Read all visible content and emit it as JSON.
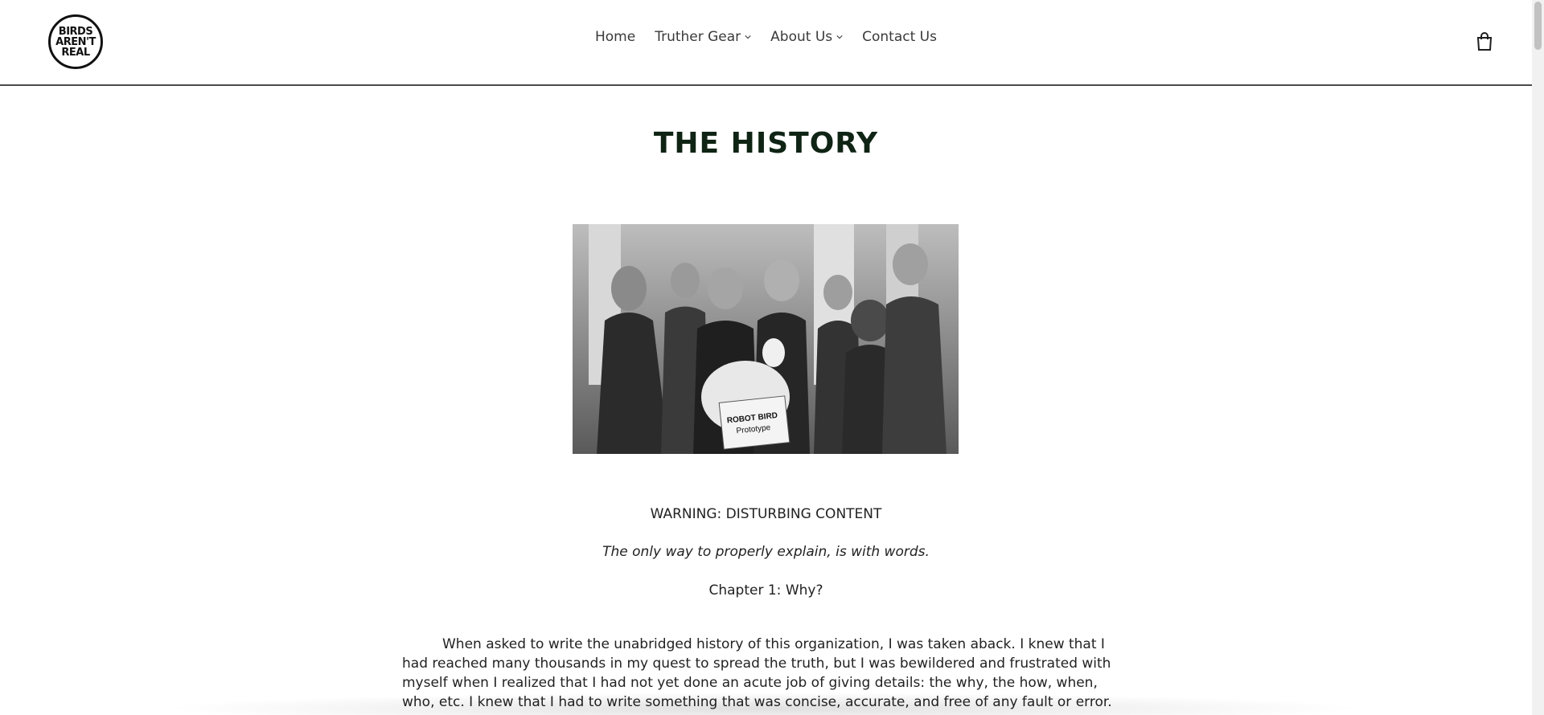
{
  "header": {
    "logo_lines": [
      "BIRDS",
      "AREN'T",
      "REAL"
    ],
    "nav": [
      {
        "label": "Home",
        "dropdown": false
      },
      {
        "label": "Truther Gear",
        "dropdown": true
      },
      {
        "label": "About Us",
        "dropdown": true
      },
      {
        "label": "Contact Us",
        "dropdown": false
      }
    ],
    "cart_icon": "shopping-bag-icon"
  },
  "main": {
    "title": "THE HISTORY",
    "hero_image": {
      "description_sign": "ROBOT BIRD\nPrototype",
      "sign_line1": "ROBOT BIRD",
      "sign_line2": "Prototype"
    },
    "warning": "WARNING: DISTURBING CONTENT",
    "lead": "The only way to properly explain, is with words.",
    "chapter": "Chapter 1: Why?",
    "paragraph": "When asked to write the unabridged history of this organization, I was taken aback. I knew that I had reached many thousands in my quest to spread the truth, but I was bewildered and frustrated with myself when I realized that I had not yet done an acute job of giving details: the why, the how, when, who, etc. I knew that I had to write something that was concise, accurate, and free of any fault or error."
  },
  "colors": {
    "title": "#0f2414",
    "text": "#222222",
    "header_border": "#4a4a4a"
  }
}
